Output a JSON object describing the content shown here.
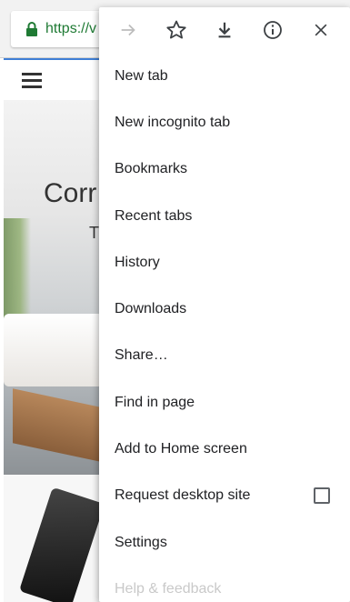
{
  "browser": {
    "url_text": "https://",
    "url_overflow_char": "v"
  },
  "page": {
    "hero_title": "Corr",
    "hero_subtitle": "T"
  },
  "menu": {
    "icons": [
      {
        "name": "forward-icon",
        "glyph": "→"
      },
      {
        "name": "bookmark-star-icon",
        "glyph": "☆"
      },
      {
        "name": "download-icon",
        "glyph": "⤓"
      },
      {
        "name": "info-icon",
        "glyph": "ⓘ"
      },
      {
        "name": "close-icon",
        "glyph": "✕"
      }
    ],
    "items": [
      {
        "label": "New tab"
      },
      {
        "label": "New incognito tab"
      },
      {
        "label": "Bookmarks"
      },
      {
        "label": "Recent tabs"
      },
      {
        "label": "History"
      },
      {
        "label": "Downloads"
      },
      {
        "label": "Share…"
      },
      {
        "label": "Find in page"
      },
      {
        "label": "Add to Home screen"
      },
      {
        "label": "Request desktop site"
      },
      {
        "label": "Settings"
      },
      {
        "label": "Help & feedback"
      }
    ],
    "colors": {
      "icon_enabled": "#3c4043",
      "icon_disabled": "#bdbdbd",
      "secure_green": "#1f7a34"
    }
  }
}
